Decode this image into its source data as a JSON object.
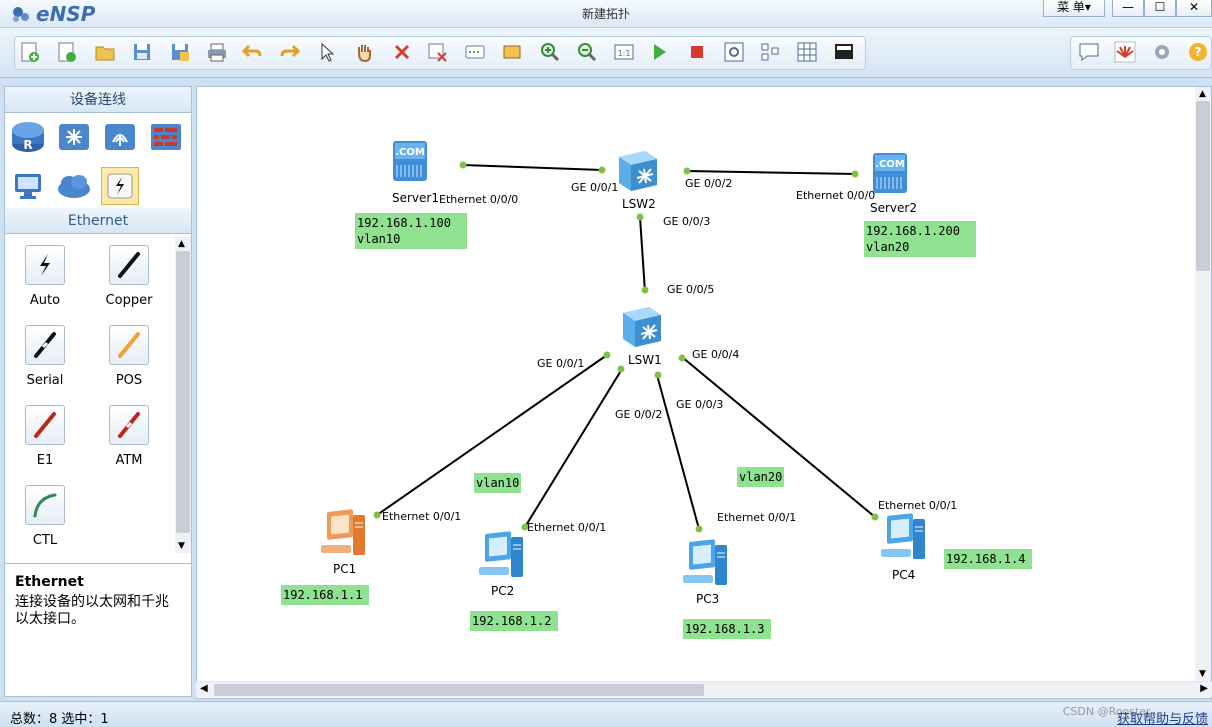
{
  "app": {
    "logo_text": "eNSP",
    "window_title": "新建拓扑",
    "menu_label": "菜 单▾"
  },
  "window_controls": {
    "minimize": "—",
    "maximize": "☐",
    "close": "✕"
  },
  "toolbar": {
    "buttons": [
      {
        "name": "new-topology-icon"
      },
      {
        "name": "new-test-icon"
      },
      {
        "name": "open-icon"
      },
      {
        "name": "save-icon"
      },
      {
        "name": "save-as-icon"
      },
      {
        "name": "print-icon"
      },
      {
        "name": "undo-icon"
      },
      {
        "name": "redo-icon"
      },
      {
        "name": "select-pointer-icon"
      },
      {
        "name": "pan-hand-icon"
      },
      {
        "name": "delete-icon"
      },
      {
        "name": "delete-link-icon"
      },
      {
        "name": "text-note-icon"
      },
      {
        "name": "palette-icon"
      },
      {
        "name": "zoom-in-icon"
      },
      {
        "name": "zoom-out-icon"
      },
      {
        "name": "fit-view-icon"
      },
      {
        "name": "start-device-icon"
      },
      {
        "name": "stop-device-icon"
      },
      {
        "name": "capture-icon"
      },
      {
        "name": "topology-icon"
      },
      {
        "name": "grid-icon"
      },
      {
        "name": "cli-screen-icon"
      }
    ],
    "right_buttons": [
      {
        "name": "chat-icon"
      },
      {
        "name": "huawei-icon"
      },
      {
        "name": "settings-gear-icon"
      },
      {
        "name": "help-icon"
      }
    ]
  },
  "left_panel": {
    "header": "设备连线",
    "categories": [
      {
        "name": "router-category-icon"
      },
      {
        "name": "switch-category-icon"
      },
      {
        "name": "wlan-category-icon"
      },
      {
        "name": "firewall-category-icon"
      },
      {
        "name": "terminal-category-icon"
      },
      {
        "name": "cloud-category-icon"
      },
      {
        "name": "cable-category-icon",
        "selected": true
      }
    ],
    "section_title": "Ethernet",
    "cables": [
      {
        "label": "Auto",
        "color": "#111111"
      },
      {
        "label": "Copper",
        "color": "#111111"
      },
      {
        "label": "Serial",
        "color": "#111111"
      },
      {
        "label": "POS",
        "color": "#f0a030"
      },
      {
        "label": "E1",
        "color": "#b8281c"
      },
      {
        "label": "ATM",
        "color": "#b8281c"
      },
      {
        "label": "CTL",
        "color": "#2e8b57"
      }
    ],
    "info_title": "Ethernet",
    "info_text": "连接设备的以太网和千兆以太接口。"
  },
  "topology": {
    "devices": [
      {
        "id": "Server1",
        "label": "Server1",
        "type": "server"
      },
      {
        "id": "LSW2",
        "label": "LSW2",
        "type": "switch"
      },
      {
        "id": "Server2",
        "label": "Server2",
        "type": "server"
      },
      {
        "id": "LSW1",
        "label": "LSW1",
        "type": "switch"
      },
      {
        "id": "PC1",
        "label": "PC1",
        "type": "pc-selected"
      },
      {
        "id": "PC2",
        "label": "PC2",
        "type": "pc"
      },
      {
        "id": "PC3",
        "label": "PC3",
        "type": "pc"
      },
      {
        "id": "PC4",
        "label": "PC4",
        "type": "pc"
      }
    ],
    "port_labels": {
      "server1_eth": "Ethernet 0/0/0",
      "lsw2_g1": "GE 0/0/1",
      "lsw2_g2": "GE 0/0/2",
      "server2_eth": "Ethernet 0/0/0",
      "lsw2_g3": "GE 0/0/3",
      "lsw1_g5": "GE 0/0/5",
      "lsw1_g1": "GE 0/0/1",
      "lsw1_g4": "GE 0/0/4",
      "lsw1_g2": "GE 0/0/2",
      "lsw1_g3": "GE 0/0/3",
      "pc1_eth": "Ethernet 0/0/1",
      "pc2_eth": "Ethernet 0/0/1",
      "pc3_eth": "Ethernet 0/0/1",
      "pc4_eth": "Ethernet 0/0/1"
    },
    "notes": {
      "server1": "192.168.1.100\nvlan10",
      "server2": "192.168.1.200\nvlan20",
      "vlan10": "vlan10",
      "vlan20": "vlan20",
      "pc1": "192.168.1.1",
      "pc2": "192.168.1.2",
      "pc3": "192.168.1.3",
      "pc4": "192.168.1.4"
    },
    "colors": {
      "port_dot": "#7dc242",
      "link": "#000000",
      "note_bg": "#8fe28f"
    }
  },
  "status_bar": {
    "left": "总数：8 选中：1",
    "right": "获取帮助与反馈",
    "watermark": "CSDN @Rooster..."
  }
}
